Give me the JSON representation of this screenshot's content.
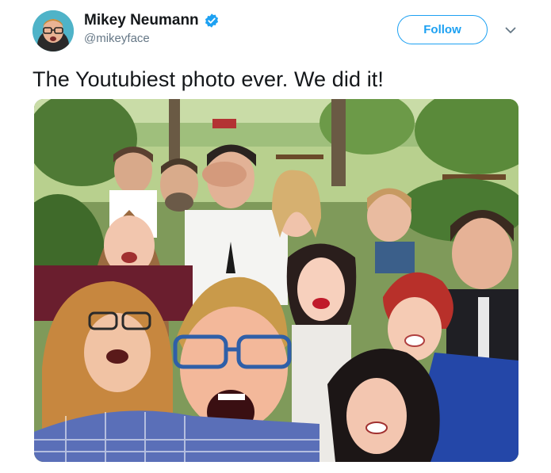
{
  "author": {
    "display_name": "Mikey Neumann",
    "handle": "@mikeyface",
    "verified": true,
    "avatar_icon": "avatar-photo"
  },
  "actions": {
    "follow_label": "Follow",
    "more_icon": "chevron-down-icon"
  },
  "tweet": {
    "text": "The Youtubiest photo ever. We did it!"
  },
  "media": {
    "type": "photo",
    "description_icon": "group-selfie-photo"
  },
  "colors": {
    "accent": "#1da1f2",
    "text": "#14171a",
    "secondary_text": "#657786"
  }
}
